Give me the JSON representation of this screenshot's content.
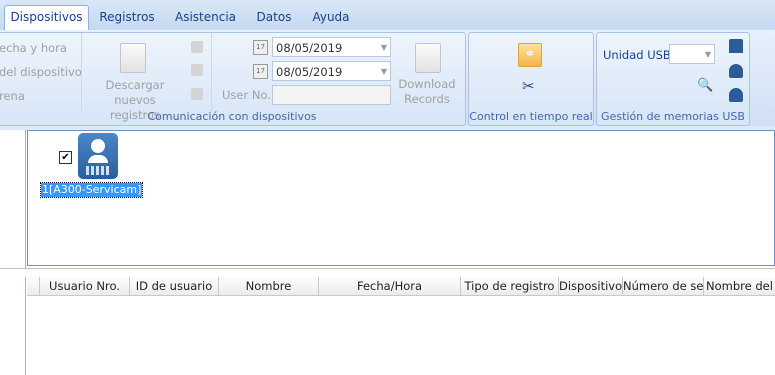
{
  "menu": {
    "tabs": [
      "Dispositivos",
      "Registros",
      "Asistencia",
      "Datos",
      "Ayuda"
    ]
  },
  "ribbon": {
    "comm": {
      "left_items": [
        "echa y hora",
        "del dispositivo",
        "rena"
      ],
      "download_new": [
        "Descargar",
        "nuevos registros"
      ],
      "date_from": "08/05/2019",
      "date_to": "08/05/2019",
      "user_no_label": "User No.",
      "user_no_value": "",
      "download_records": [
        "Download",
        "Records"
      ],
      "group_label": "Comunicación con dispositivos"
    },
    "realtime": {
      "group_label": "Control en tiempo real"
    },
    "usb": {
      "unit_label": "Unidad USB",
      "unit_value": "",
      "group_label": "Gestión de memorias USB"
    }
  },
  "devices": [
    {
      "label": "1[A300-Servicam]",
      "checked": true
    }
  ],
  "records_table": {
    "columns": [
      "Usuario Nro.",
      "ID de usuario",
      "Nombre",
      "Fecha/Hora",
      "Tipo de registro",
      "Dispositivo",
      "Número de se",
      "Nombre del d"
    ]
  },
  "colors": {
    "accent": "#15428b",
    "selection": "#3399ff",
    "device_icon": "#2f6db5"
  }
}
